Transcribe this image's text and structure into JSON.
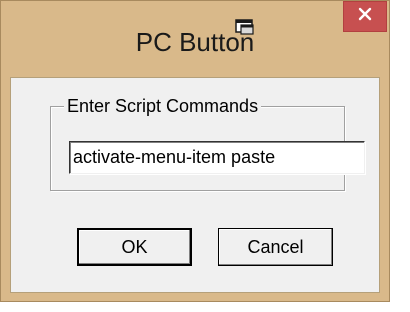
{
  "window": {
    "title": "PC Button",
    "title_icon": "window-icon",
    "close_icon": "close-icon",
    "colors": {
      "frame": "#d9b98a",
      "close_button": "#c75050",
      "client": "#f0f0f0"
    }
  },
  "dialog": {
    "group_label": "Enter Script Commands",
    "command_value": "activate-menu-item paste",
    "ok_label": "OK",
    "cancel_label": "Cancel"
  }
}
